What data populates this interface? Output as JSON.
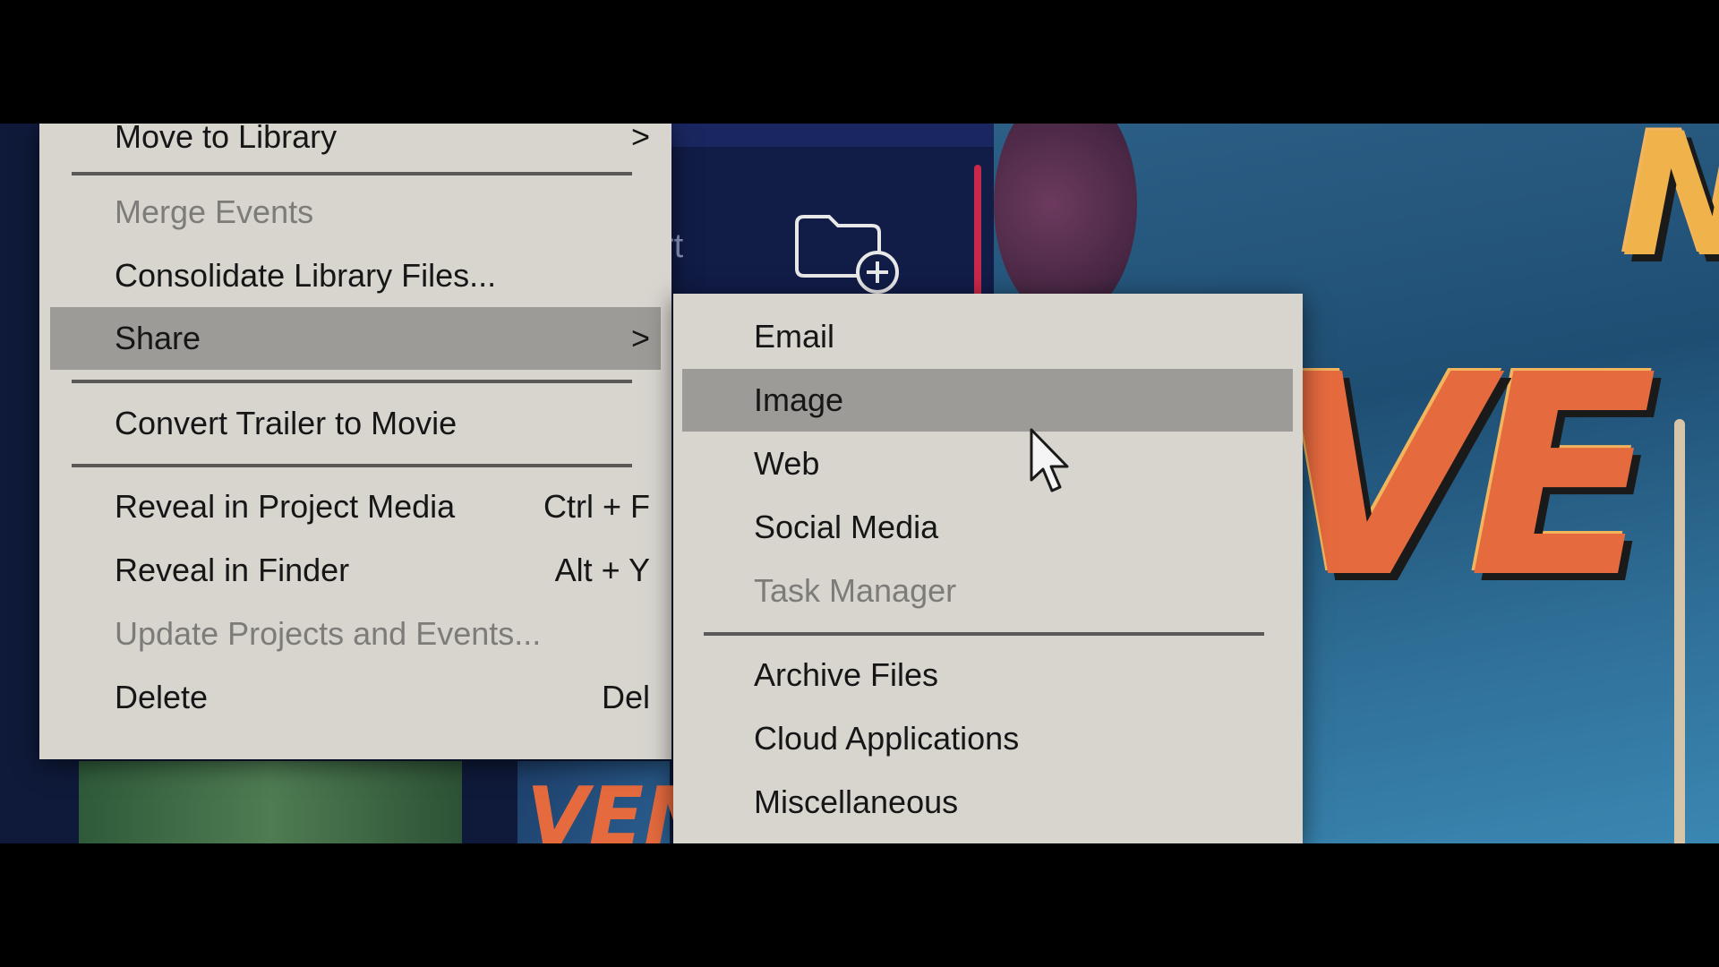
{
  "main_menu": {
    "items": [
      {
        "label": "Move to Library",
        "shortcut": ">"
      },
      {
        "label": "Merge Events",
        "shortcut": ""
      },
      {
        "label": "Consolidate Library Files...",
        "shortcut": ""
      },
      {
        "label": "Share",
        "shortcut": ">"
      },
      {
        "label": "Convert Trailer to Movie",
        "shortcut": ""
      },
      {
        "label": "Reveal in Project Media",
        "shortcut": "Ctrl + F"
      },
      {
        "label": "Reveal in Finder",
        "shortcut": "Alt + Y"
      },
      {
        "label": "Update Projects and Events...",
        "shortcut": ""
      },
      {
        "label": "Delete",
        "shortcut": "Del"
      }
    ],
    "disabled": [
      "Merge Events",
      "Update Projects and Events..."
    ],
    "highlighted": "Share"
  },
  "share_submenu": {
    "items": [
      {
        "label": "Email"
      },
      {
        "label": "Image"
      },
      {
        "label": "Web"
      },
      {
        "label": "Social Media"
      },
      {
        "label": "Task Manager"
      },
      {
        "label": "Archive Files"
      },
      {
        "label": "Cloud Applications"
      },
      {
        "label": "Miscellaneous"
      }
    ],
    "disabled": [
      "Task Manager"
    ],
    "highlighted": "Image"
  },
  "background": {
    "partial_text": "rt",
    "folder_icon": "folder-add-icon"
  },
  "colors": {
    "menu_bg": "#d8d5cf",
    "highlight_bg": "#9d9b98",
    "disabled_text": "#7e7c79",
    "accent_red": "#c8284a"
  }
}
